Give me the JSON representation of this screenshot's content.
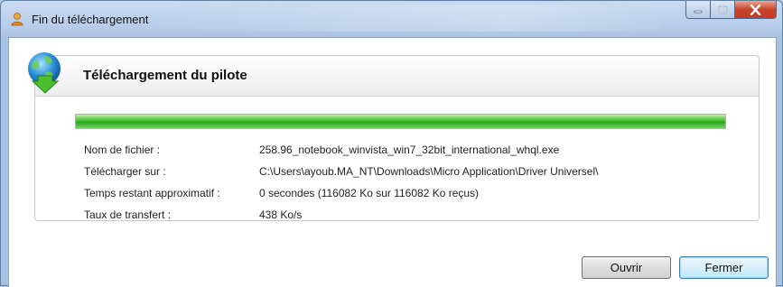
{
  "window": {
    "title": "Fin du téléchargement",
    "controls": {
      "minimize": "minimize-icon",
      "maximize": "maximize-icon",
      "close": "close-icon"
    }
  },
  "panel": {
    "title": "Téléchargement du pilote",
    "progress_fraction": 1.0,
    "rows": [
      {
        "label": "Nom de fichier :",
        "value": "258.96_notebook_winvista_win7_32bit_international_whql.exe"
      },
      {
        "label": "Télécharger sur :",
        "value": "C:\\Users\\ayoub.MA_NT\\Downloads\\Micro Application\\Driver Universel\\"
      },
      {
        "label": "Temps restant approximatif :",
        "value": "0 secondes (116082 Ko sur 116082 Ko reçus)"
      },
      {
        "label": "Taux de transfert :",
        "value": "438 Ko/s"
      }
    ]
  },
  "buttons": {
    "open": "Ouvrir",
    "close": "Fermer"
  },
  "colors": {
    "progress": "#3fbd2e",
    "title_bar": "#b6cce9",
    "close_control": "#c7442a"
  }
}
